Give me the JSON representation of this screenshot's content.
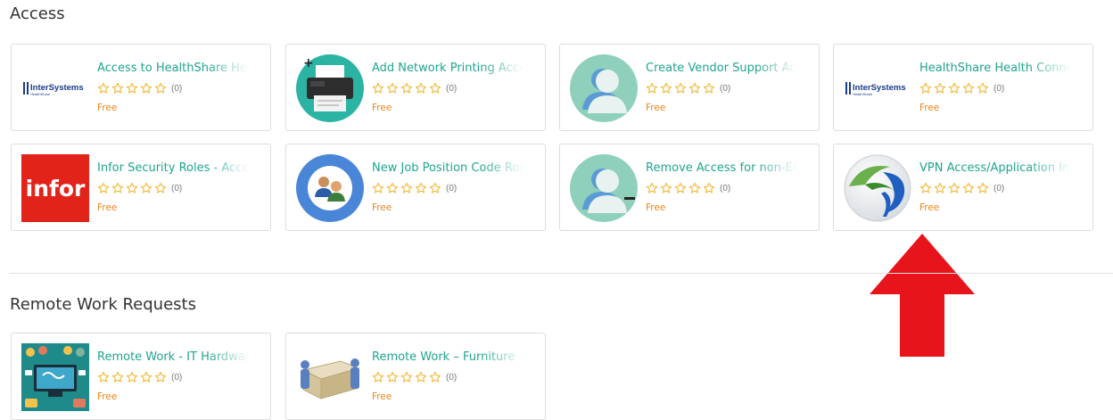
{
  "sections": [
    {
      "title": "Access",
      "items": [
        {
          "title": "Access to HealthShare Health Connect",
          "icon": "intersystems-logo-icon",
          "count": "(0)",
          "price": "Free"
        },
        {
          "title": "Add Network Printing Access",
          "icon": "printer-icon",
          "count": "(0)",
          "price": "Free"
        },
        {
          "title": "Create Vendor Support Account",
          "icon": "user-add-icon",
          "count": "(0)",
          "price": "Free"
        },
        {
          "title": "HealthShare Health Connect",
          "icon": "intersystems-logo-icon",
          "count": "(0)",
          "price": "Free"
        },
        {
          "title": "Infor Security Roles - Access",
          "icon": "infor-logo-icon",
          "count": "(0)",
          "price": "Free"
        },
        {
          "title": "New Job Position Code Role",
          "icon": "group-users-icon",
          "count": "(0)",
          "price": "Free"
        },
        {
          "title": "Remove Access for non-EH User",
          "icon": "user-remove-icon",
          "count": "(0)",
          "price": "Free"
        },
        {
          "title": "VPN Access/Application Install",
          "icon": "vpn-client-icon",
          "count": "(0)",
          "price": "Free"
        }
      ]
    },
    {
      "title": "Remote Work Requests",
      "items": [
        {
          "title": "Remote Work - IT Hardware",
          "icon": "remote-work-illustration-icon",
          "count": "(0)",
          "price": "Free"
        },
        {
          "title": "Remote Work – Furniture",
          "icon": "furniture-box-icon",
          "count": "(0)",
          "price": "Free"
        }
      ]
    }
  ],
  "colors": {
    "title": "#1fa58e",
    "price": "#e8861b",
    "star": "#f0b429",
    "annotation_arrow": "#e8141b"
  }
}
